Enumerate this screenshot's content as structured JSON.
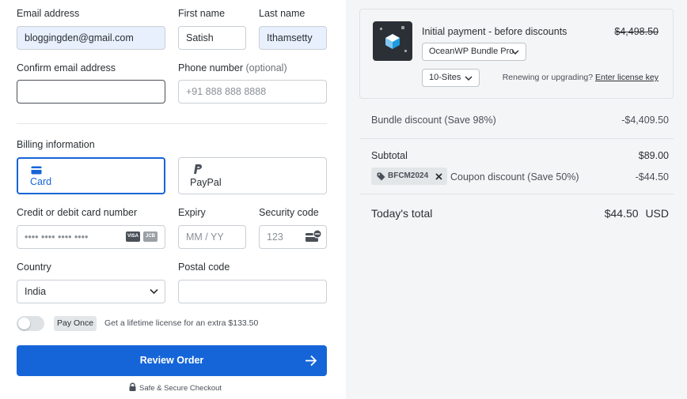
{
  "form": {
    "email": {
      "label": "Email address",
      "value": "bloggingden@gmail.com"
    },
    "first_name": {
      "label": "First name",
      "value": "Satish"
    },
    "last_name": {
      "label": "Last name",
      "value": "Ithamsetty"
    },
    "confirm_email": {
      "label": "Confirm email address",
      "value": ""
    },
    "phone": {
      "label": "Phone number",
      "label_suffix": "(optional)",
      "placeholder": "+91 888 888 8888"
    },
    "billing_title": "Billing information",
    "tabs": [
      {
        "label": "Card",
        "icon": "card-icon",
        "active": true
      },
      {
        "label": "PayPal",
        "icon": "paypal-icon",
        "active": false
      }
    ],
    "card_number": {
      "label": "Credit or debit card number",
      "placeholder": "•••• •••• •••• ••••",
      "brands": [
        "VISA",
        "JCB"
      ]
    },
    "expiry": {
      "label": "Expiry",
      "placeholder": "MM / YY"
    },
    "security": {
      "label": "Security code",
      "placeholder": "123"
    },
    "country": {
      "label": "Country",
      "value": "India"
    },
    "postal": {
      "label": "Postal code",
      "value": ""
    },
    "pay_once": {
      "badge": "Pay Once",
      "text": "Get a lifetime license for an extra $133.50",
      "on": false
    },
    "review_button": "Review Order",
    "secure_text": "Safe & Secure Checkout"
  },
  "summary": {
    "product_title": "Initial payment - before discounts",
    "original_price": "$4,498.50",
    "product_select": "OceanWP Bundle Pro",
    "sites_select": "10-Sites",
    "renew_text": "Renewing or upgrading?",
    "renew_link": "Enter license key",
    "bundle_discount_label": "Bundle discount (Save 98%)",
    "bundle_discount_value": "-$4,409.50",
    "subtotal_label": "Subtotal",
    "subtotal_value": "$89.00",
    "coupon_code": "BFCM2024",
    "coupon_label": "Coupon discount (Save 50%)",
    "coupon_value": "-$44.50",
    "total_label": "Today's total",
    "total_value": "$44.50",
    "total_currency": "USD"
  },
  "colors": {
    "primary": "#1565d8",
    "autofill": "#e8f0fe",
    "panel": "#f4f5f6"
  }
}
